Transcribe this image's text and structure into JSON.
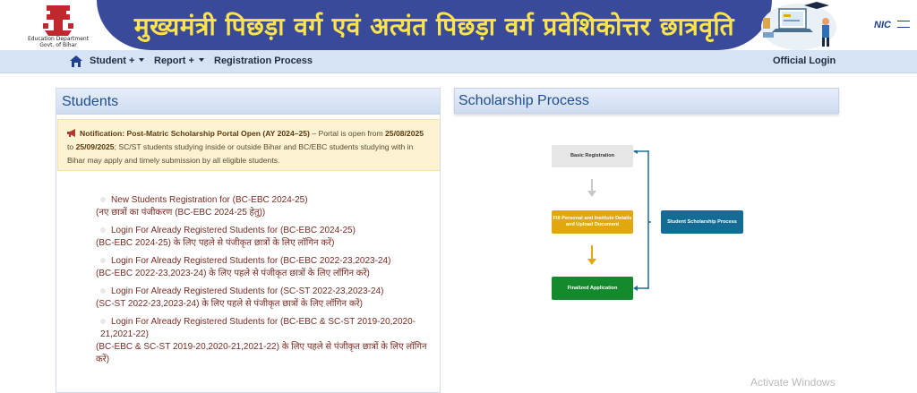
{
  "header": {
    "title": "मुख्यमंत्री पिछड़ा वर्ग एवं अत्यंत पिछड़ा वर्ग प्रवेशिकोत्तर छात्रवृति",
    "logo_caption_line1": "Education Department",
    "logo_caption_line2": "Govt. of Bihar",
    "nic_label": "NIC"
  },
  "navbar": {
    "items": [
      {
        "label": "Student +",
        "has_caret": true
      },
      {
        "label": "Report +",
        "has_caret": true
      },
      {
        "label": "Registration Process",
        "has_caret": false
      }
    ],
    "login_label": "Official Login"
  },
  "students": {
    "title": "Students",
    "notice": {
      "icon": "megaphone-icon",
      "heading": "Notification: Post-Matric Scholarship Portal Open (AY 2024–25)",
      "text_1": " – Portal is open from ",
      "date_from": "25/08/2025",
      "text_to": " to ",
      "date_to": "25/09/2025",
      "text_2": "; SC/ST students studying inside or outside Bihar and BC/EBC students studying with in Bihar may apply and timely submission by all eligible students."
    },
    "links": [
      {
        "en": "New Students Registration for (BC-EBC 2024-25)",
        "hi": "(नए छात्रों का पंजीकरण (BC-EBC 2024-25 हेतु))"
      },
      {
        "en": "Login For Already Registered Students for (BC-EBC 2024-25)",
        "hi": "(BC-EBC 2024-25) के लिए पहले से पंजीकृत छात्रों के लिए लॉगिन करें)"
      },
      {
        "en": "Login For Already Registered Students for (BC-EBC 2022-23,2023-24)",
        "hi": "(BC-EBC 2022-23,2023-24) के लिए पहले से पंजीकृत छात्रों के लिए लॉगिन करें)"
      },
      {
        "en": "Login For Already Registered Students for (SC-ST 2022-23,2023-24)",
        "hi": "(SC-ST 2022-23,2023-24) के लिए पहले से पंजीकृत छात्रों के लिए लॉगिन करें)"
      },
      {
        "en": "Login For Already Registered Students for (BC-EBC & SC-ST 2019-20,2020-21,2021-22)",
        "hi": "(BC-EBC & SC-ST 2019-20,2020-21,2021-22) के लिए पहले से पंजीकृत छात्रों के लिए लॉगिन करें)"
      }
    ]
  },
  "scholarship": {
    "title": "Scholarship Process",
    "steps": {
      "basic": "Basic Registration",
      "fill": "Fill Personal and Institute Details and Upload Document",
      "final": "Finalized Application",
      "side": "Student Scholarship Process"
    },
    "colors": {
      "basic": "#e6e6e6",
      "fill": "#e0a80c",
      "final": "#148a2c",
      "side": "#126c93",
      "arrow_gray": "#c8c8c8",
      "arrow_orange": "#e0a80c",
      "bracket": "#1e6e8e"
    }
  },
  "watermark": "Activate Windows"
}
